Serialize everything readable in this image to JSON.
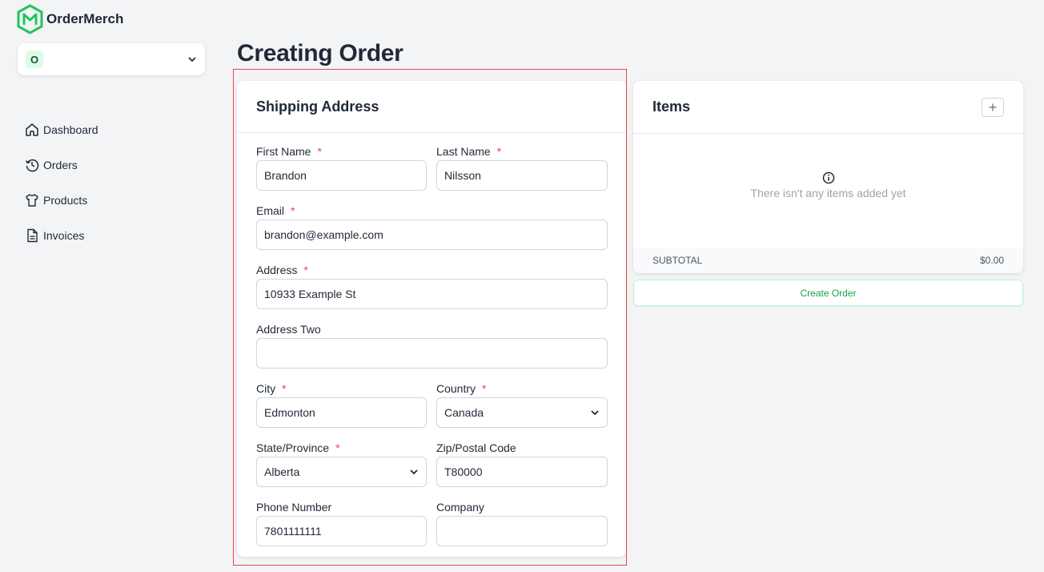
{
  "app": {
    "name": "OrderMerch"
  },
  "org_selector": {
    "badge": "O"
  },
  "nav": {
    "items": [
      {
        "label": "Dashboard",
        "icon": "home-icon"
      },
      {
        "label": "Orders",
        "icon": "history-icon"
      },
      {
        "label": "Products",
        "icon": "shirt-icon"
      },
      {
        "label": "Invoices",
        "icon": "file-icon"
      }
    ]
  },
  "page": {
    "title": "Creating Order"
  },
  "shipping": {
    "title": "Shipping Address",
    "required_marker": "*",
    "first_name": {
      "label": "First Name",
      "value": "Brandon"
    },
    "last_name": {
      "label": "Last Name",
      "value": "Nilsson"
    },
    "email": {
      "label": "Email",
      "value": "brandon@example.com"
    },
    "address": {
      "label": "Address",
      "value": "10933 Example St"
    },
    "address_two": {
      "label": "Address Two",
      "value": ""
    },
    "city": {
      "label": "City",
      "value": "Edmonton"
    },
    "country": {
      "label": "Country",
      "value": "Canada"
    },
    "state": {
      "label": "State/Province",
      "value": "Alberta"
    },
    "zip": {
      "label": "Zip/Postal Code",
      "value": "T80000"
    },
    "phone": {
      "label": "Phone Number",
      "value": "7801111111"
    },
    "company": {
      "label": "Company",
      "value": ""
    }
  },
  "items": {
    "title": "Items",
    "add_symbol": "+",
    "empty_text": "There isn't any items added yet",
    "subtotal_label": "SUBTOTAL",
    "subtotal_value": "$0.00"
  },
  "actions": {
    "create_order": "Create Order"
  },
  "colors": {
    "brand": "#22c55e",
    "required": "#ef4444",
    "highlight": "#ef4444"
  }
}
